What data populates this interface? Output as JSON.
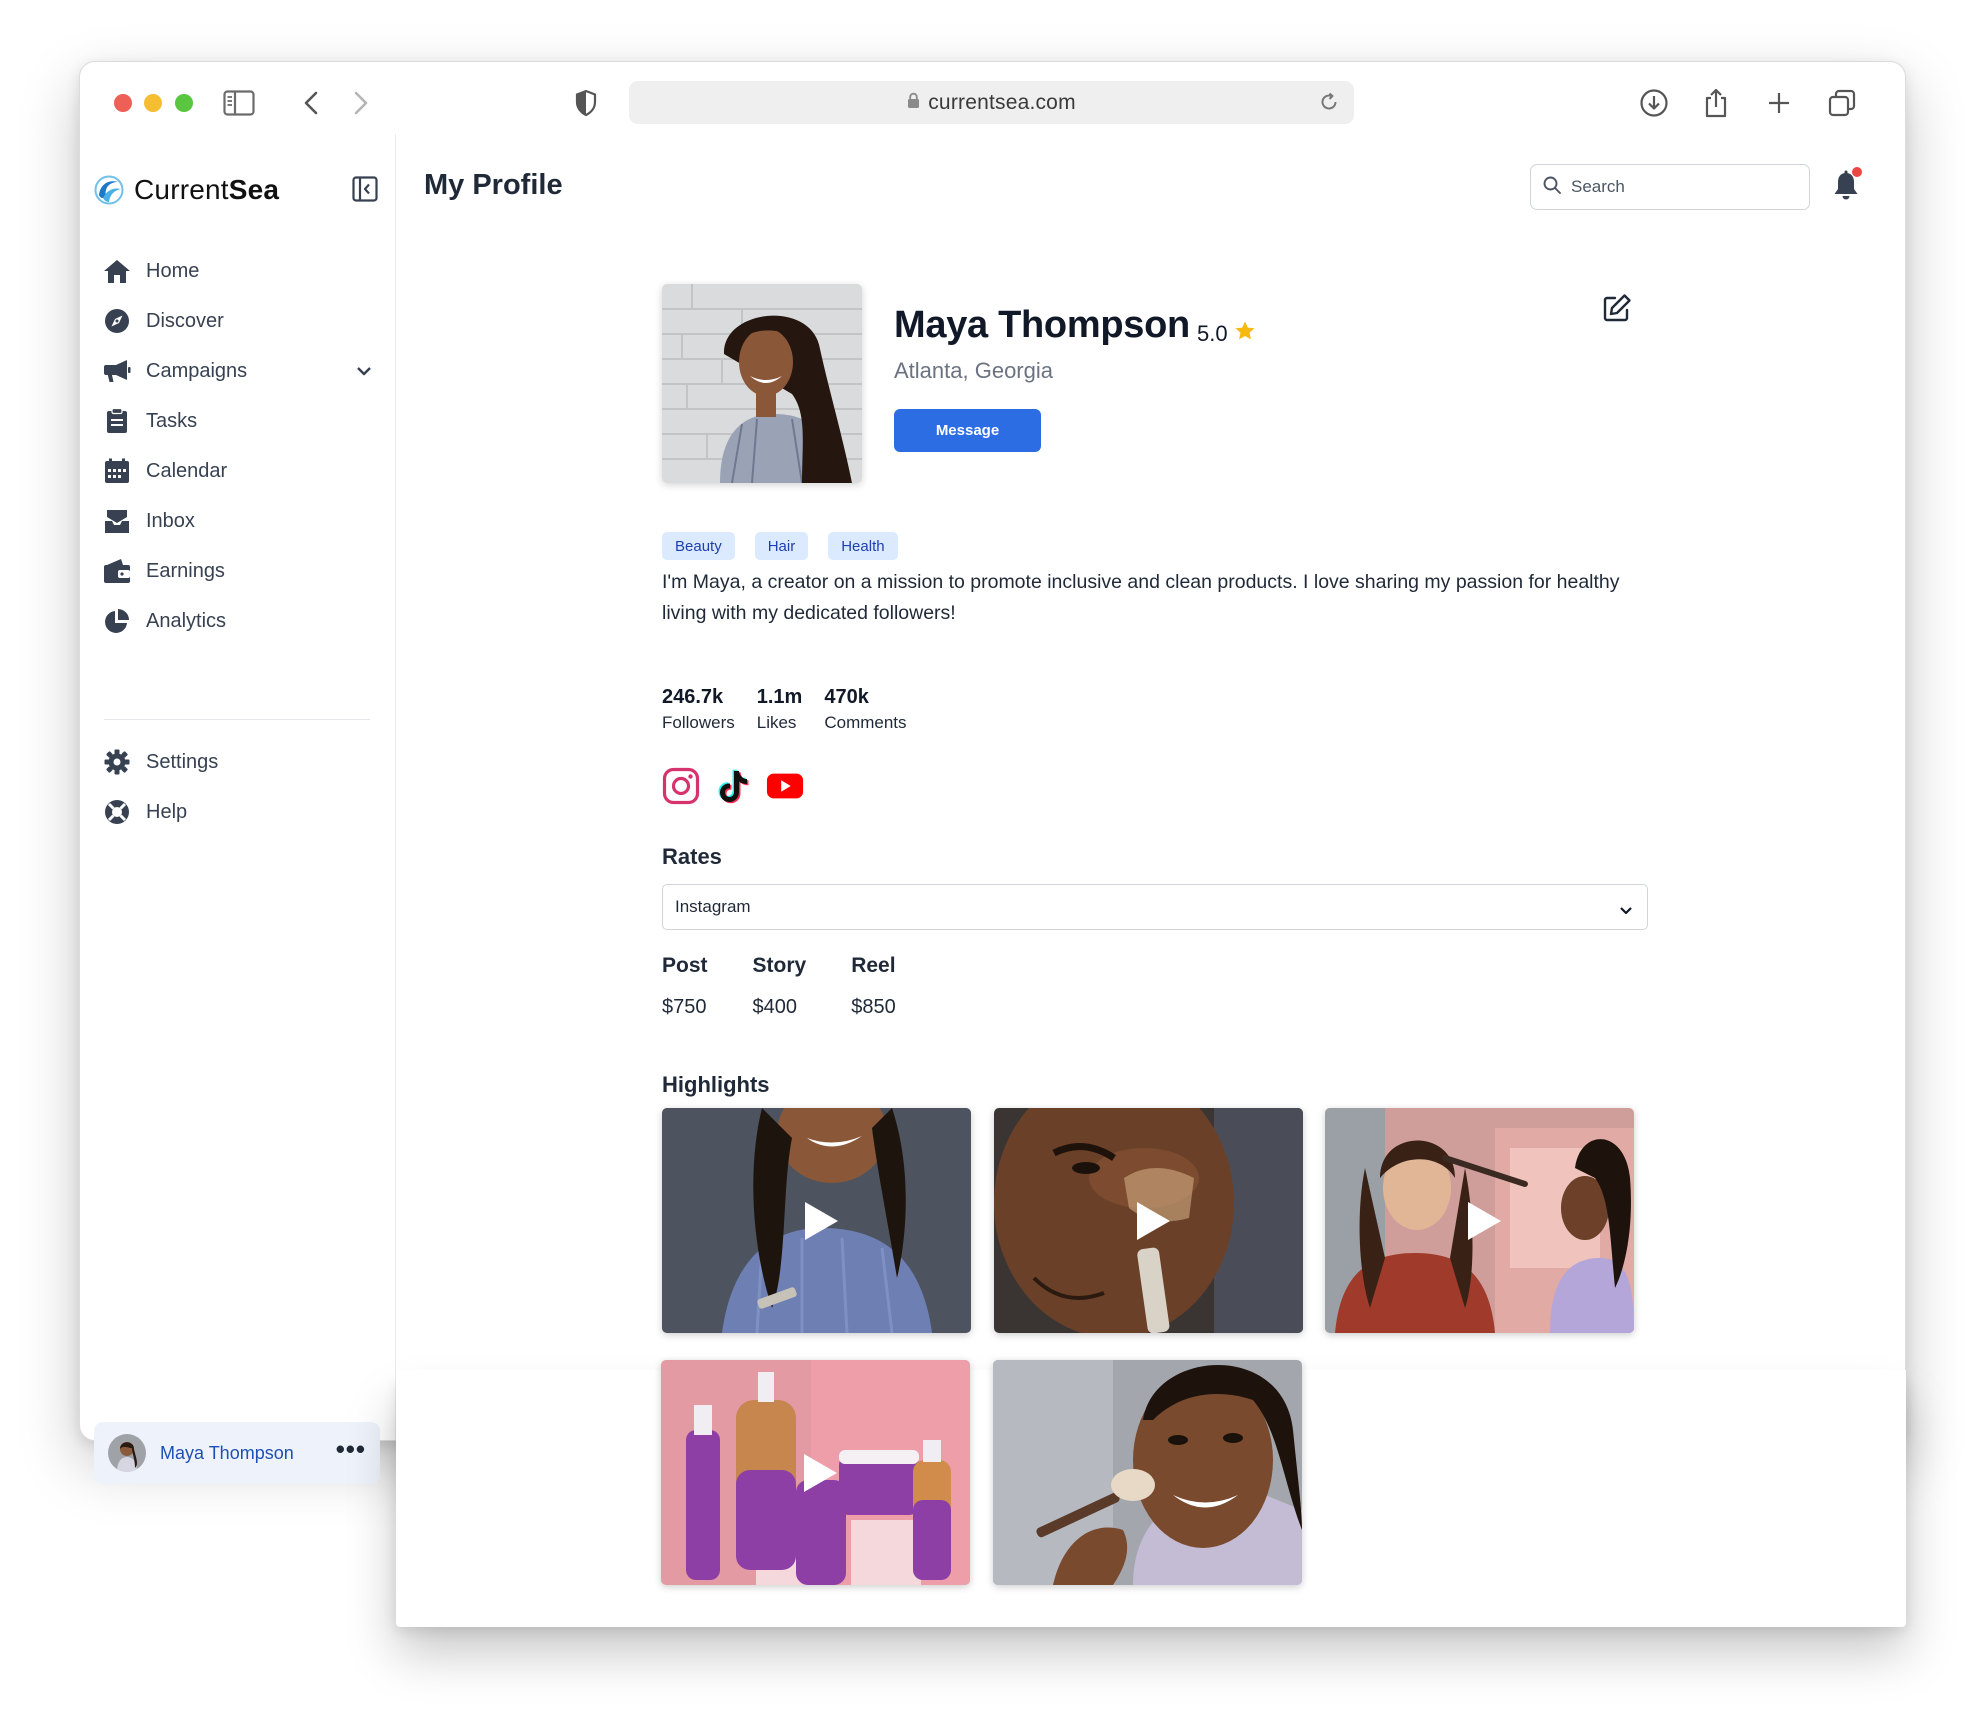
{
  "browser": {
    "url": "currentsea.com"
  },
  "brand": {
    "name_regular": "Current",
    "name_bold": "Sea"
  },
  "sidebar": {
    "items": [
      {
        "label": "Home",
        "icon": "home-icon"
      },
      {
        "label": "Discover",
        "icon": "compass-icon"
      },
      {
        "label": "Campaigns",
        "icon": "megaphone-icon"
      },
      {
        "label": "Tasks",
        "icon": "clipboard-icon"
      },
      {
        "label": "Calendar",
        "icon": "calendar-icon"
      },
      {
        "label": "Inbox",
        "icon": "inbox-icon"
      },
      {
        "label": "Earnings",
        "icon": "wallet-icon"
      },
      {
        "label": "Analytics",
        "icon": "pie-chart-icon"
      }
    ],
    "secondary": [
      {
        "label": "Settings",
        "icon": "gear-icon"
      },
      {
        "label": "Help",
        "icon": "lifebuoy-icon"
      }
    ],
    "user": {
      "name": "Maya Thompson",
      "more": "•••"
    }
  },
  "header": {
    "title": "My Profile",
    "search_placeholder": "Search"
  },
  "profile": {
    "name": "Maya Thompson",
    "rating": "5.0",
    "location": "Atlanta, Georgia",
    "message_label": "Message",
    "tags": [
      "Beauty",
      "Hair",
      "Health"
    ],
    "bio": "I'm Maya, a creator on a mission to promote inclusive and clean products. I love sharing my passion for healthy living with my dedicated followers!",
    "stats": [
      {
        "value": "246.7k",
        "label": "Followers"
      },
      {
        "value": "1.1m",
        "label": "Likes"
      },
      {
        "value": "470k",
        "label": "Comments"
      }
    ],
    "socials": [
      "instagram-icon",
      "tiktok-icon",
      "youtube-icon"
    ]
  },
  "rates": {
    "heading": "Rates",
    "platform": "Instagram",
    "items": [
      {
        "type": "Post",
        "price": "$750"
      },
      {
        "type": "Story",
        "price": "$400"
      },
      {
        "type": "Reel",
        "price": "$850"
      }
    ]
  },
  "highlights": {
    "heading": "Highlights"
  },
  "colors": {
    "accent": "#2d6de3",
    "tag_bg": "#dbeafe",
    "tag_text": "#1e40af",
    "notification": "#ef4444",
    "star": "#f5b90f"
  }
}
